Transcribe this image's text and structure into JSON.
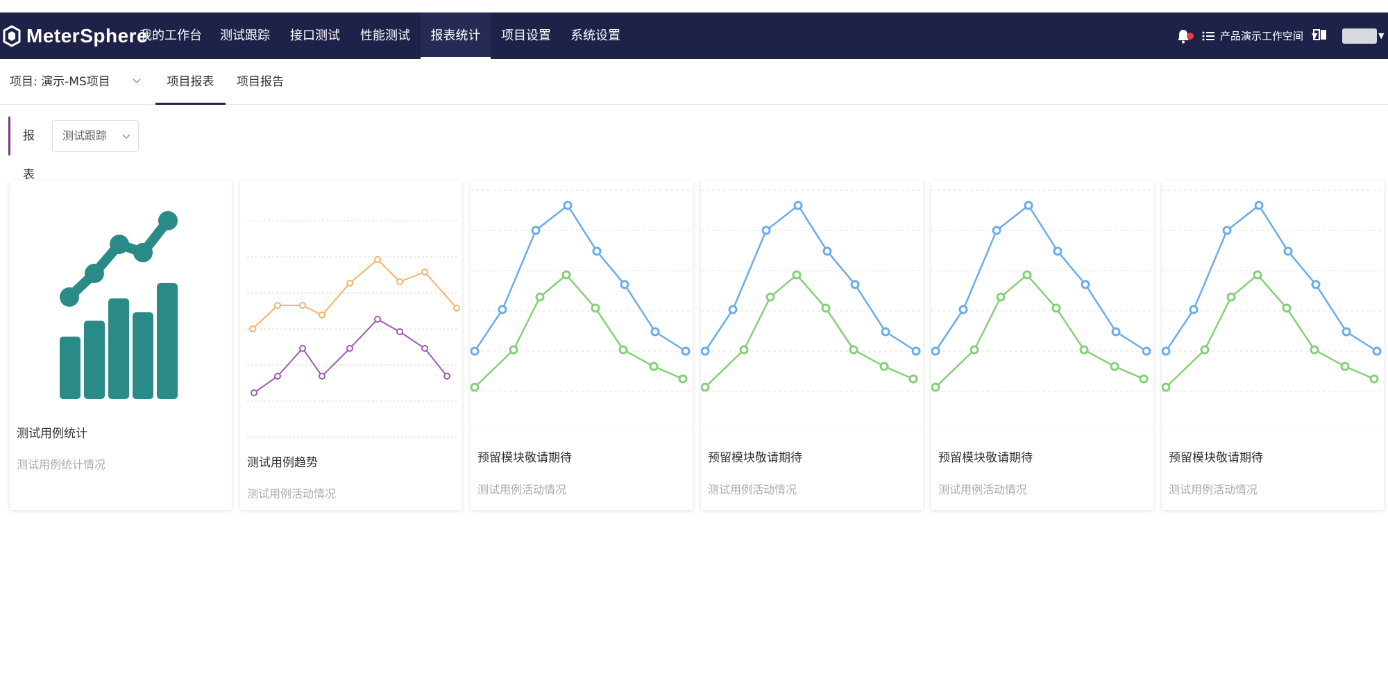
{
  "nav": {
    "brand": "MeterSphere",
    "items": [
      {
        "label": "我的工作台"
      },
      {
        "label": "测试跟踪"
      },
      {
        "label": "接口测试"
      },
      {
        "label": "性能测试"
      },
      {
        "label": "报表统计",
        "active": true
      },
      {
        "label": "项目设置"
      },
      {
        "label": "系统设置"
      }
    ],
    "workspace": "产品演示工作空间"
  },
  "subnav": {
    "project_label": "项目: 演示-MS项目",
    "tabs": [
      {
        "label": "项目报表",
        "active": true
      },
      {
        "label": "项目报告"
      }
    ]
  },
  "report": {
    "label": "报表",
    "select_value": "测试跟踪"
  },
  "cards": [
    {
      "title": "测试用例统计",
      "description": "测试用例统计情况",
      "thumbnail": "bar-trend-icon"
    },
    {
      "title": "测试用例趋势",
      "description": "测试用例活动情况",
      "thumbnail": "dual-line-chart"
    },
    {
      "title": "预留模块敬请期待",
      "description": "测试用例活动情况",
      "thumbnail": "line-chart"
    },
    {
      "title": "预留模块敬请期待",
      "description": "测试用例活动情况",
      "thumbnail": "line-chart"
    },
    {
      "title": "预留模块敬请期待",
      "description": "测试用例活动情况",
      "thumbnail": "line-chart"
    },
    {
      "title": "预留模块敬请期待",
      "description": "测试用例活动情况",
      "thumbnail": "line-chart"
    }
  ],
  "colors": {
    "navbar": "#1e2248",
    "accent": "#783887",
    "teal": "#2a8a87",
    "orange": "#f5b367",
    "purple": "#a05ab3",
    "blue": "#6aacea",
    "green": "#86cf79"
  }
}
